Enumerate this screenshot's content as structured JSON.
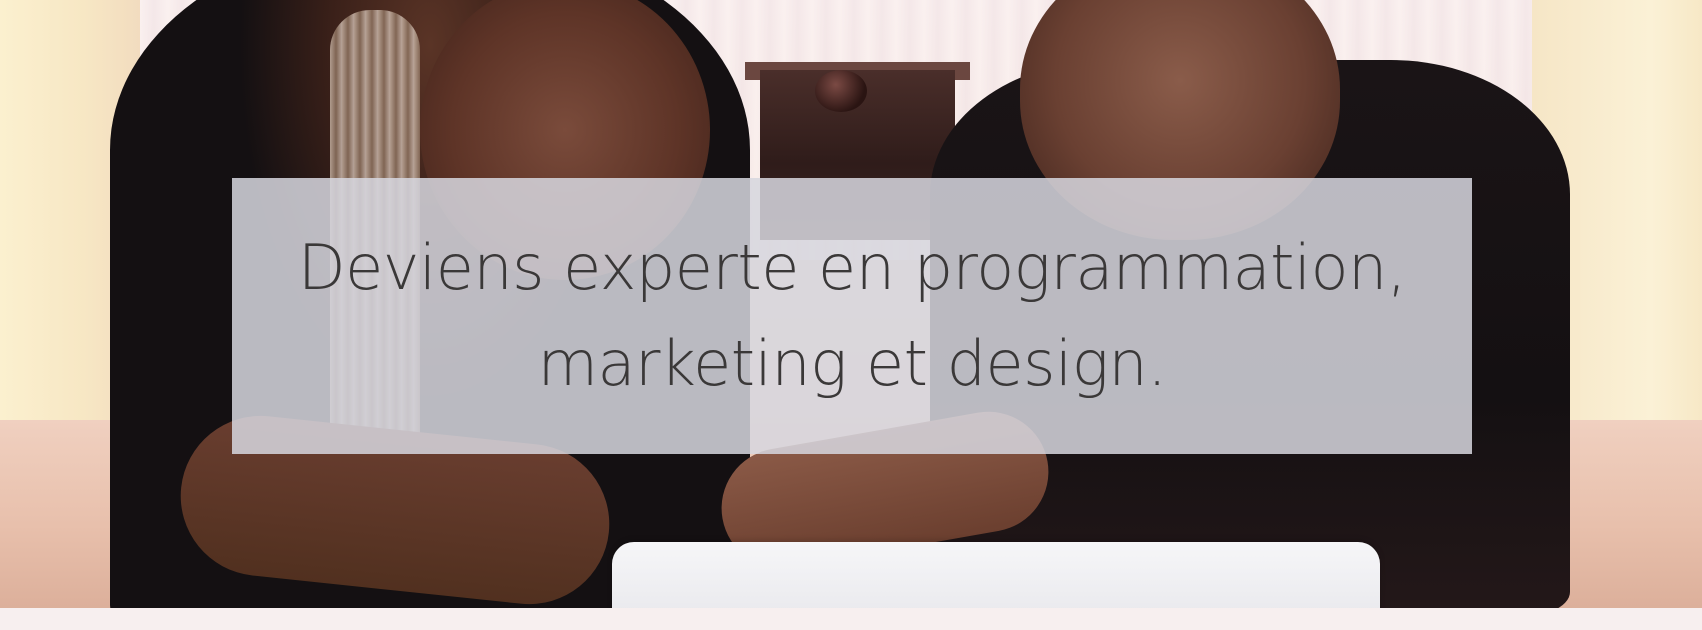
{
  "hero": {
    "headline_line1": "Deviens experte en programmation,",
    "headline_line2": "marketing et design.",
    "overlay_color": "#d6d6de",
    "text_color": "#3a3838"
  }
}
